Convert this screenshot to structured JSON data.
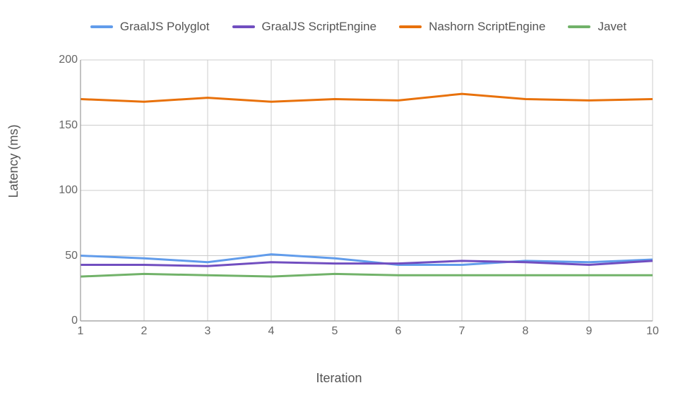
{
  "chart_data": {
    "type": "line",
    "xlabel": "Iteration",
    "ylabel": "Latency (ms)",
    "ylim": [
      0,
      200
    ],
    "x": [
      1,
      2,
      3,
      4,
      5,
      6,
      7,
      8,
      9,
      10
    ],
    "y_ticks": [
      0,
      50,
      100,
      150,
      200
    ],
    "series": [
      {
        "name": "GraalJS Polyglot",
        "color": "#619CEB",
        "values": [
          50,
          48,
          45,
          51,
          48,
          43,
          43,
          46,
          45,
          47
        ]
      },
      {
        "name": "GraalJS ScriptEngine",
        "color": "#714EC0",
        "values": [
          43,
          43,
          42,
          45,
          44,
          44,
          46,
          45,
          43,
          46
        ]
      },
      {
        "name": "Nashorn ScriptEngine",
        "color": "#E8710B",
        "values": [
          170,
          168,
          171,
          168,
          170,
          169,
          174,
          170,
          169,
          170
        ]
      },
      {
        "name": "Javet",
        "color": "#71B269",
        "values": [
          34,
          36,
          35,
          34,
          36,
          35,
          35,
          35,
          35,
          35
        ]
      }
    ]
  }
}
